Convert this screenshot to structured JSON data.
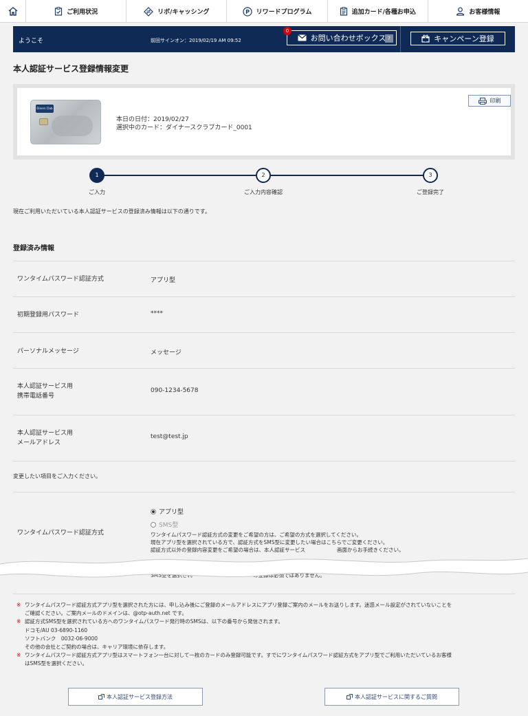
{
  "nav": {
    "home_icon": "home-icon",
    "items": [
      {
        "label": "ご利用状況",
        "icon": "clipboard-check-icon"
      },
      {
        "label": "リボ/キャッシング",
        "icon": "diamond-arrows-icon"
      },
      {
        "label": "リワードプログラム",
        "icon": "p-circle-icon"
      },
      {
        "label": "追加カード/各種お申込",
        "icon": "document-list-icon"
      },
      {
        "label": "お客様情報",
        "icon": "person-icon"
      }
    ]
  },
  "header": {
    "welcome": "ようこそ",
    "last_signin": "前回サインオン：2019/02/19 AM 09:52",
    "inquiry_label": "お問い合わせボックス",
    "inquiry_badge": "0",
    "inquiry_help": "?",
    "campaign_label": "キャンペーン登録"
  },
  "page_title": "本人認証サービス登録情報変更",
  "card": {
    "logo_text": "Diners Club",
    "date_line": "本日の日付：2019/02/27",
    "card_line": "選択中のカード：ダイナースクラブカード_0001",
    "print_label": "印刷"
  },
  "steps": [
    {
      "num": "1",
      "label": "ご入力"
    },
    {
      "num": "2",
      "label": "ご入力内容確認"
    },
    {
      "num": "3",
      "label": "ご登録完了"
    }
  ],
  "intro": "現在ご利用いただいている本人認証サービスの登録済み情報は以下の通りです。",
  "registered": {
    "title": "登録済み情報",
    "rows": [
      {
        "key": "ワンタイムパスワード認証方式",
        "value": "アプリ型"
      },
      {
        "key": "初期登録用パスワード",
        "value": "****"
      },
      {
        "key": "パーソナルメッセージ",
        "value": "メッセージ"
      },
      {
        "key1": "本人認証サービス用",
        "key2": "携帯電話番号",
        "value": "090-1234-5678"
      },
      {
        "key1": "本人認証サービス用",
        "key2": "メールアドレス",
        "value": "test@test.jp"
      }
    ]
  },
  "change": {
    "note": "変更したい項目をご入力ください。",
    "key": "ワンタイムパスワード認証方式",
    "option1": "アプリ型",
    "option2": "SMS型",
    "desc1": "ワンタイムパスワード認証方式の変更をご希望の方は、ご希望の方式を選択してください。",
    "desc2": "現在アプリ型を選択されている方で、認証方式をSMS型に変更したい場合はこちらでご変更ください。",
    "desc3": "認証方式以外の登録内容変更をご希望の場合は、本人認証サービス",
    "desc4": "画面からお手続きください。",
    "desc5": "SMS型を選択され",
    "desc6": "の登録は必須ではありません。"
  },
  "notes": {
    "n1a": "ワンタイムパスワード認証方式アプリ型を選択された方には、申し込み後にご登録のメールアドレスにアプリ登録ご案内のメールをお送りします。迷惑メール設定がされていないことを",
    "n1b": "ご確認ください。ご案内メールのドメインは、@otp-auth.net です。",
    "n2a": "認証方式SMS型を選択されている方へのワンタイムパスワード発行時のSMSは、以下の番号から発信されます。",
    "n2b": "ドコモ/AU 03-6890-1160",
    "n2c": "ソフトバンク　0032-06-9000",
    "n2d": "その他の会社とご契約の場合は、キャリア環境に依存します。",
    "n3a": "ワンタイムパスワード認証方式アプリ型はスマートフォン一台に対して一枚のカードのみ登録可能です。すでにワンタイムパスワード認証方式をアプリ型でご利用いただいているお客様",
    "n3b": "はSMS型を選択ください。",
    "mark": "※"
  },
  "buttons": {
    "how_to": "本人認証サービス登録方法",
    "faq": "本人認証サービスに関するご質問"
  }
}
